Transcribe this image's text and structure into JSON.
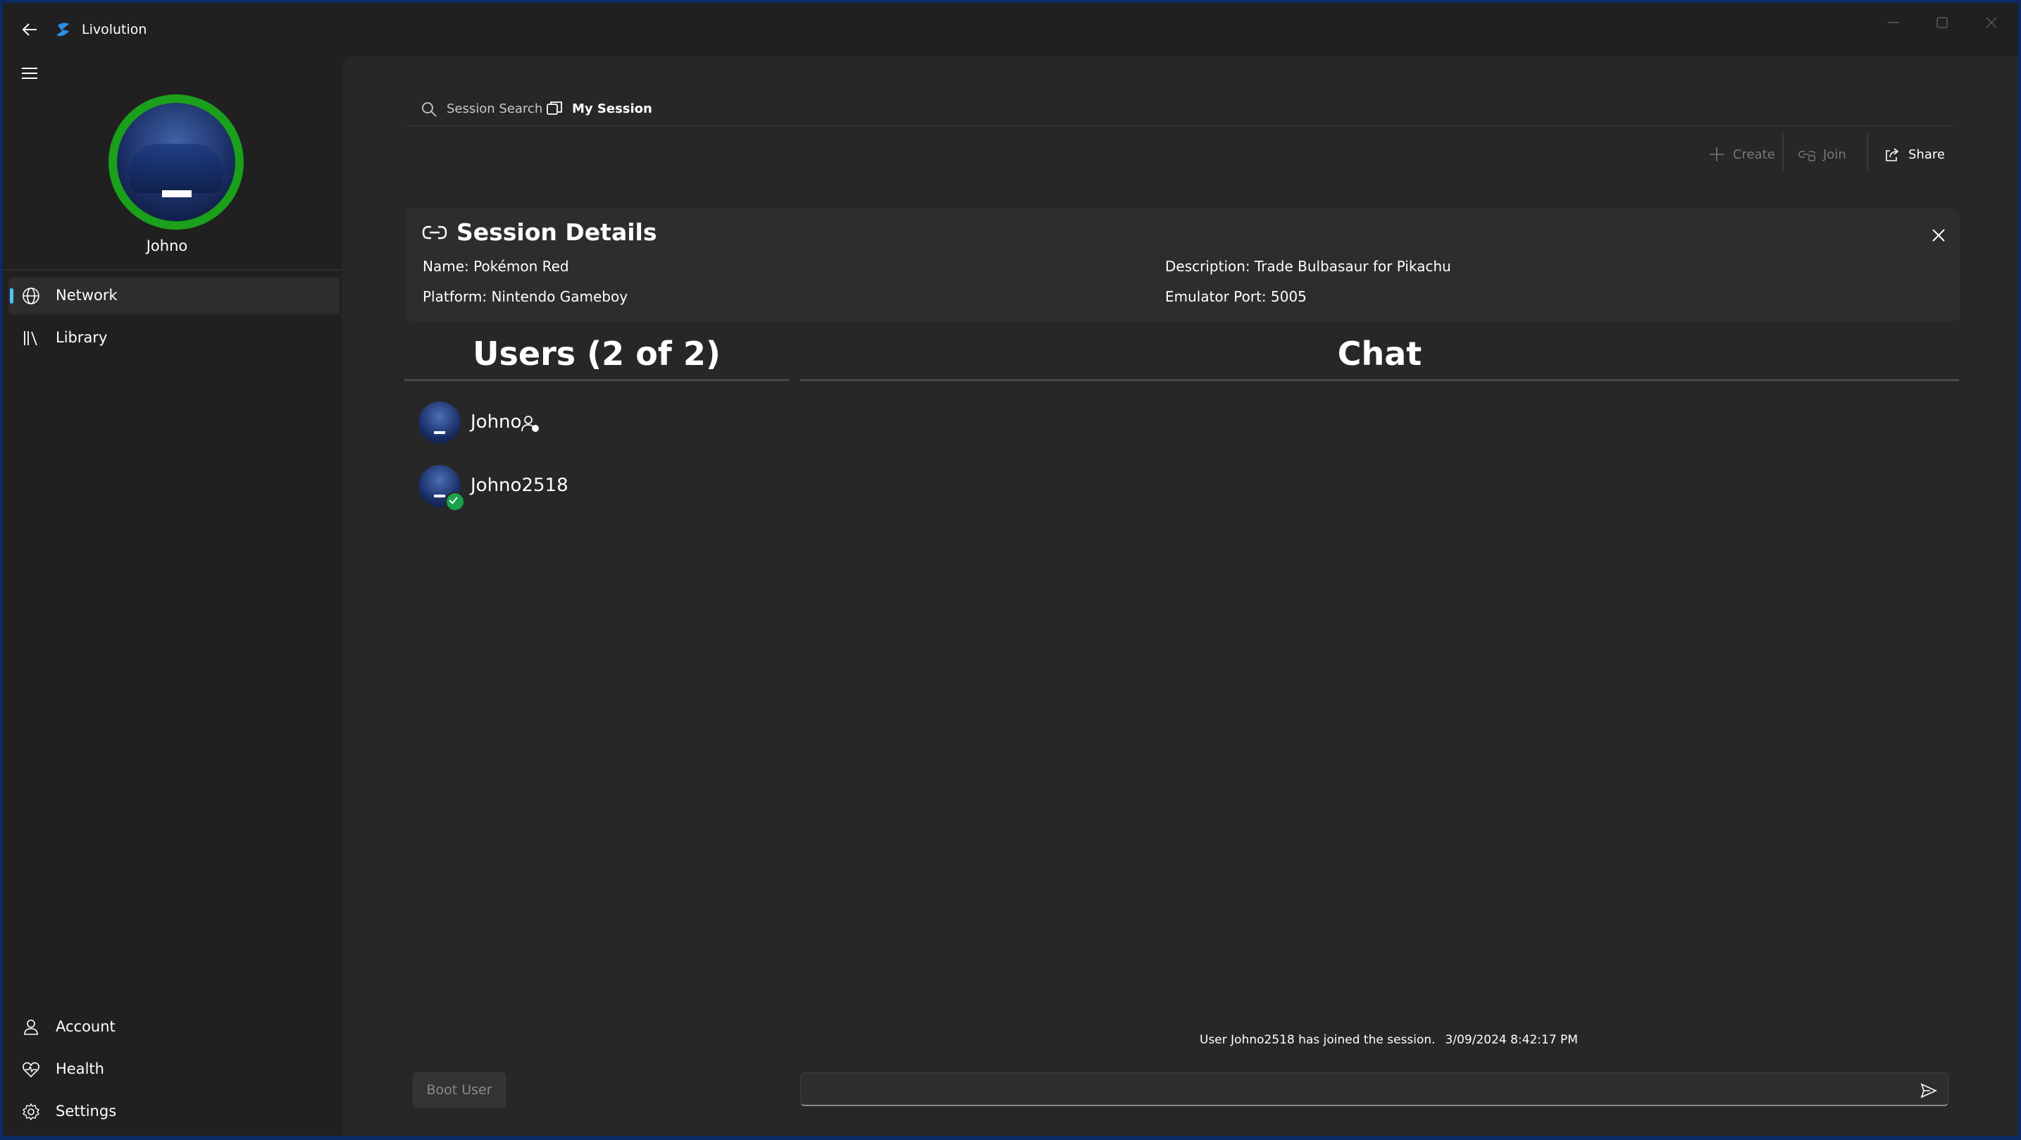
{
  "app": {
    "title": "Livolution"
  },
  "profile": {
    "name": "Johno"
  },
  "nav": {
    "items": [
      {
        "label": "Network",
        "icon": "globe-icon",
        "active": true
      },
      {
        "label": "Library",
        "icon": "library-icon",
        "active": false
      }
    ],
    "footer": [
      {
        "label": "Account",
        "icon": "person-icon"
      },
      {
        "label": "Health",
        "icon": "heart-pulse-icon"
      },
      {
        "label": "Settings",
        "icon": "gear-icon"
      }
    ]
  },
  "tabs": [
    {
      "label": "Session Search",
      "icon": "search-icon"
    },
    {
      "label": "My Session",
      "icon": "session-icon",
      "selected": true
    }
  ],
  "commands": {
    "create": "Create",
    "join": "Join",
    "share": "Share"
  },
  "session": {
    "title": "Session Details",
    "name": "Name: Pokémon Red",
    "platform": "Platform: Nintendo Gameboy",
    "description": "Description: Trade Bulbasaur for Pikachu",
    "port": "Emulator Port: 5005"
  },
  "users": {
    "header": "Users (2 of 2)",
    "list": [
      {
        "name": "Johno",
        "badge": "host-icon"
      },
      {
        "name": "Johno2518",
        "badge": "ready-check-icon"
      }
    ]
  },
  "chat": {
    "header": "Chat",
    "messages": [
      {
        "text": "User Johno2518 has joined the session.",
        "time": "3/09/2024 8:42:17 PM"
      }
    ],
    "input_value": ""
  },
  "actions": {
    "boot_user": "Boot User"
  },
  "colors": {
    "accent": "#4cc2ff",
    "avatar_ring": "#1aa01a",
    "ready": "#16a34a",
    "background": "#202020",
    "panel": "#272727"
  }
}
